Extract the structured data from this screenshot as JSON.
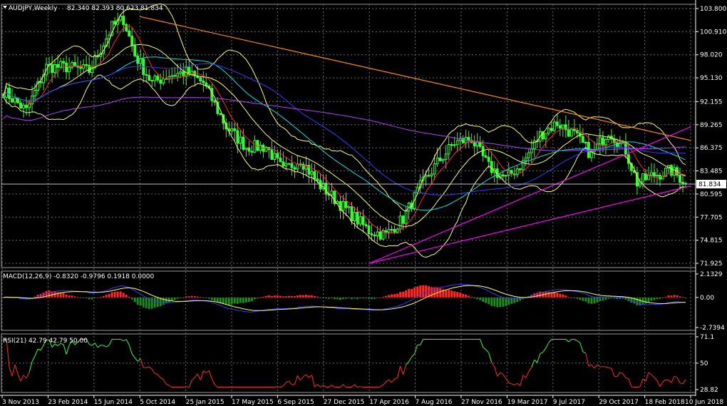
{
  "chart_data": [
    {
      "type": "candlestick",
      "title": "AUDJPY,Weekly",
      "ohlc_label": "82.340 82.393 80.623 81.834",
      "current_price": 81.834,
      "current_price_label": "81.834",
      "ylim": [
        71.925,
        103.8
      ],
      "y_ticks": [
        "103.800",
        "100.910",
        "98.020",
        "95.130",
        "92.155",
        "89.265",
        "86.375",
        "83.485",
        "80.595",
        "77.705",
        "74.815",
        "71.925"
      ],
      "x_ticks": [
        "3 Nov 2013",
        "23 Feb 2014",
        "15 Jun 2014",
        "5 Oct 2014",
        "25 Jan 2015",
        "17 May 2015",
        "6 Sep 2015",
        "27 Dec 2015",
        "17 Apr 2016",
        "7 Aug 2016",
        "27 Nov 2016",
        "19 Mar 2017",
        "9 Jul 2017",
        "29 Oct 2017",
        "18 Feb 2018",
        "10 Jun 2018"
      ],
      "price_path": [
        [
          0,
          93.5
        ],
        [
          8,
          91.0
        ],
        [
          15,
          96.5
        ],
        [
          22,
          96.5
        ],
        [
          30,
          96.0
        ],
        [
          38,
          101.5
        ],
        [
          42,
          102.5
        ],
        [
          46,
          98.0
        ],
        [
          52,
          94.5
        ],
        [
          58,
          95.5
        ],
        [
          64,
          95.8
        ],
        [
          70,
          94.5
        ],
        [
          78,
          89.0
        ],
        [
          85,
          86.5
        ],
        [
          92,
          86.5
        ],
        [
          98,
          83.5
        ],
        [
          104,
          85.0
        ],
        [
          110,
          82.0
        ],
        [
          116,
          80.0
        ],
        [
          122,
          78.0
        ],
        [
          128,
          76.0
        ],
        [
          134,
          75.5
        ],
        [
          140,
          77.5
        ],
        [
          146,
          81.5
        ],
        [
          152,
          84.5
        ],
        [
          158,
          87.0
        ],
        [
          164,
          87.5
        ],
        [
          170,
          84.0
        ],
        [
          176,
          82.5
        ],
        [
          182,
          84.5
        ],
        [
          188,
          88.0
        ],
        [
          194,
          89.5
        ],
        [
          200,
          88.0
        ],
        [
          206,
          85.5
        ],
        [
          212,
          88.5
        ],
        [
          218,
          86.0
        ],
        [
          222,
          82.0
        ],
        [
          228,
          83.0
        ],
        [
          234,
          83.5
        ],
        [
          240,
          81.834
        ]
      ],
      "trendlines": [
        {
          "color": "#ff8c00",
          "from": [
            "5 Oct 2014",
            102.8
          ],
          "to": [
            "10 Jun 2018",
            87.3
          ]
        },
        {
          "color": "#ff00ff",
          "from": [
            "17 Apr 2016",
            71.925
          ],
          "to": [
            "10 Jun 2018",
            89.0
          ]
        },
        {
          "color": "#ff00ff",
          "from": [
            "17 Apr 2016",
            71.925
          ],
          "to": [
            "10 Jun 2018",
            81.6
          ]
        }
      ],
      "indicators": {
        "bollinger_color": "#ffff66",
        "ma_fast_color": "#ff2a2a",
        "ma_mid_color": "#00e5e5",
        "ma_slow_color": "#3a3aff",
        "ma_long_color": "#b040ff",
        "candle_color": "#33ff33"
      }
    },
    {
      "type": "histogram",
      "title": "MACD(12,26,9) -0.8320 -0.9796 0.1918 0.0000",
      "y_ticks": [
        "2.1329",
        "0.00",
        "-2.7394"
      ],
      "ylim": [
        -2.7394,
        2.1329
      ],
      "positive_color": "#ff2a2a",
      "negative_color": "#1e8c1e",
      "signal_color": "#ffff66",
      "macd_color": "#3a3aff"
    },
    {
      "type": "line",
      "title": "RSI(21) 42.79 42.79 50.00",
      "y_ticks": [
        "71.1",
        "50",
        "28.82"
      ],
      "ylim": [
        28.82,
        71.1
      ],
      "level": 50,
      "above_color": "#33ff33",
      "below_color": "#ff2a2a"
    }
  ]
}
